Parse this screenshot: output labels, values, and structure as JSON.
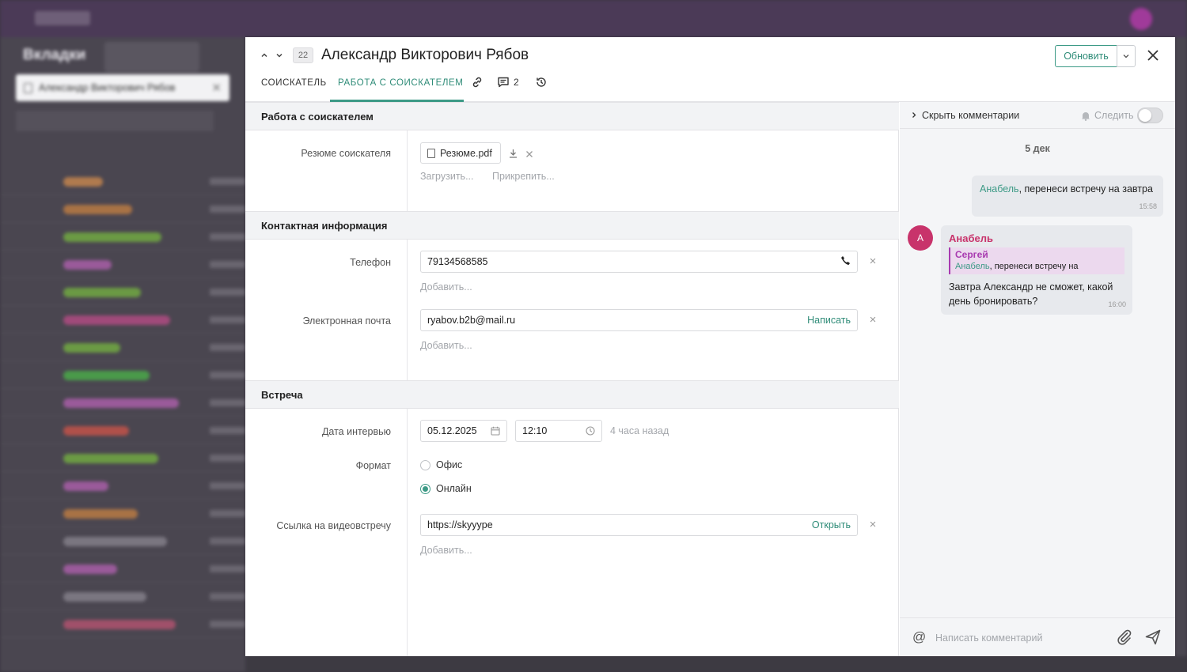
{
  "background": {
    "section_title": "Вкладки",
    "open_tab_label": "Александр Викторович Рябов",
    "row_tag_colors": [
      "#b07a4e",
      "#a87245",
      "#6b9a44",
      "#9a5a9a",
      "#6b9a44",
      "#a04a7a",
      "#6b9a44",
      "#4a9a4a",
      "#9a5a9a",
      "#b0504a",
      "#6b9a44",
      "#9a5a9a",
      "#a87245",
      "#7a7680",
      "#9a5a9a",
      "#7a7680",
      "#a0506a"
    ]
  },
  "modal": {
    "record_id": "22",
    "title": "Александр Викторович Рябов",
    "update_label": "Обновить",
    "tabs": [
      {
        "label": "СОИСКАТЕЛЬ"
      },
      {
        "label": "РАБОТА С СОИСКАТЕЛЕМ"
      }
    ],
    "comments_count": "2"
  },
  "form": {
    "section1": "Работа с соискателем",
    "resume_label": "Резюме соискателя",
    "resume_file": "Резюме.pdf",
    "upload_label": "Загрузить...",
    "attach_label": "Прикрепить...",
    "section2": "Контактная информация",
    "phone_label": "Телефон",
    "phone_value": "79134568585",
    "add_label": "Добавить...",
    "email_label": "Электронная почта",
    "email_value": "ryabov.b2b@mail.ru",
    "email_action": "Написать",
    "section3": "Встреча",
    "interview_label": "Дата интервью",
    "interview_date": "05.12.2025",
    "interview_time": "12:10",
    "interview_relative": "4 часа назад",
    "format_label": "Формат",
    "format_options": [
      "Офис",
      "Онлайн"
    ],
    "format_selected": "Онлайн",
    "video_label": "Ссылка на видеовстречу",
    "video_value": "https://skyyype",
    "video_action": "Открыть"
  },
  "comments": {
    "hide_label": "Скрыть комментарии",
    "follow_label": "Следить",
    "date": "5 дек",
    "messages": [
      {
        "mention": "Анабель",
        "text": ", перенеси встречу на завтра",
        "time": "15:58"
      },
      {
        "avatar": "А",
        "author": "Анабель",
        "quote_author": "Сергей",
        "quote_mention": "Анабель",
        "quote_text": ", перенеси встречу на",
        "text": "Завтра Александр не сможет, какой день бронировать?",
        "time": "16:00"
      }
    ],
    "input_placeholder": "Написать комментарий"
  },
  "colors": {
    "accent": "#3d9a86",
    "author": "#c8336b",
    "quote": "#a83ab0"
  }
}
